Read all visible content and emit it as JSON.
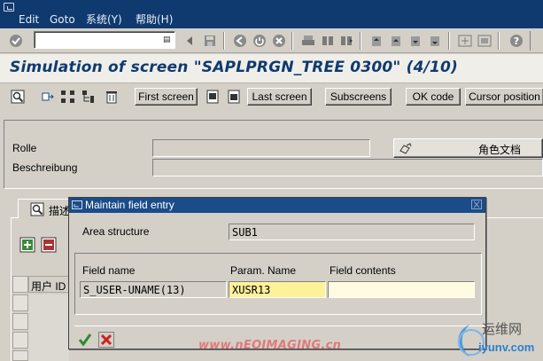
{
  "menu": {
    "items": [
      "Edit",
      "Goto",
      "系统(Y)",
      "帮助(H)"
    ]
  },
  "title": "Simulation of screen \"SAPLPRGN_TREE 0300\" (4/10)",
  "app_toolbar": {
    "buttons": [
      "First screen",
      "Last screen",
      "Subscreens",
      "OK code",
      "Cursor position"
    ]
  },
  "header": {
    "rolle_label": "Rolle",
    "beschreibung_label": "Beschreibung",
    "doc_button_label": "角色文档"
  },
  "tab": {
    "label": "描述"
  },
  "grid": {
    "column_header": "用户 ID"
  },
  "dialog": {
    "title": "Maintain field entry",
    "area_structure_label": "Area structure",
    "area_structure_value": "SUB1",
    "field_name_header": "Field name",
    "param_name_header": "Param. Name",
    "field_contents_header": "Field contents",
    "field_name_value": "S_USER-UNAME(13)",
    "param_name_value": "XUSR13",
    "field_contents_value": ""
  },
  "watermark": "www.nEOIMAGING.cn",
  "logo": {
    "name": "运维网",
    "url": "iyunv.com"
  }
}
